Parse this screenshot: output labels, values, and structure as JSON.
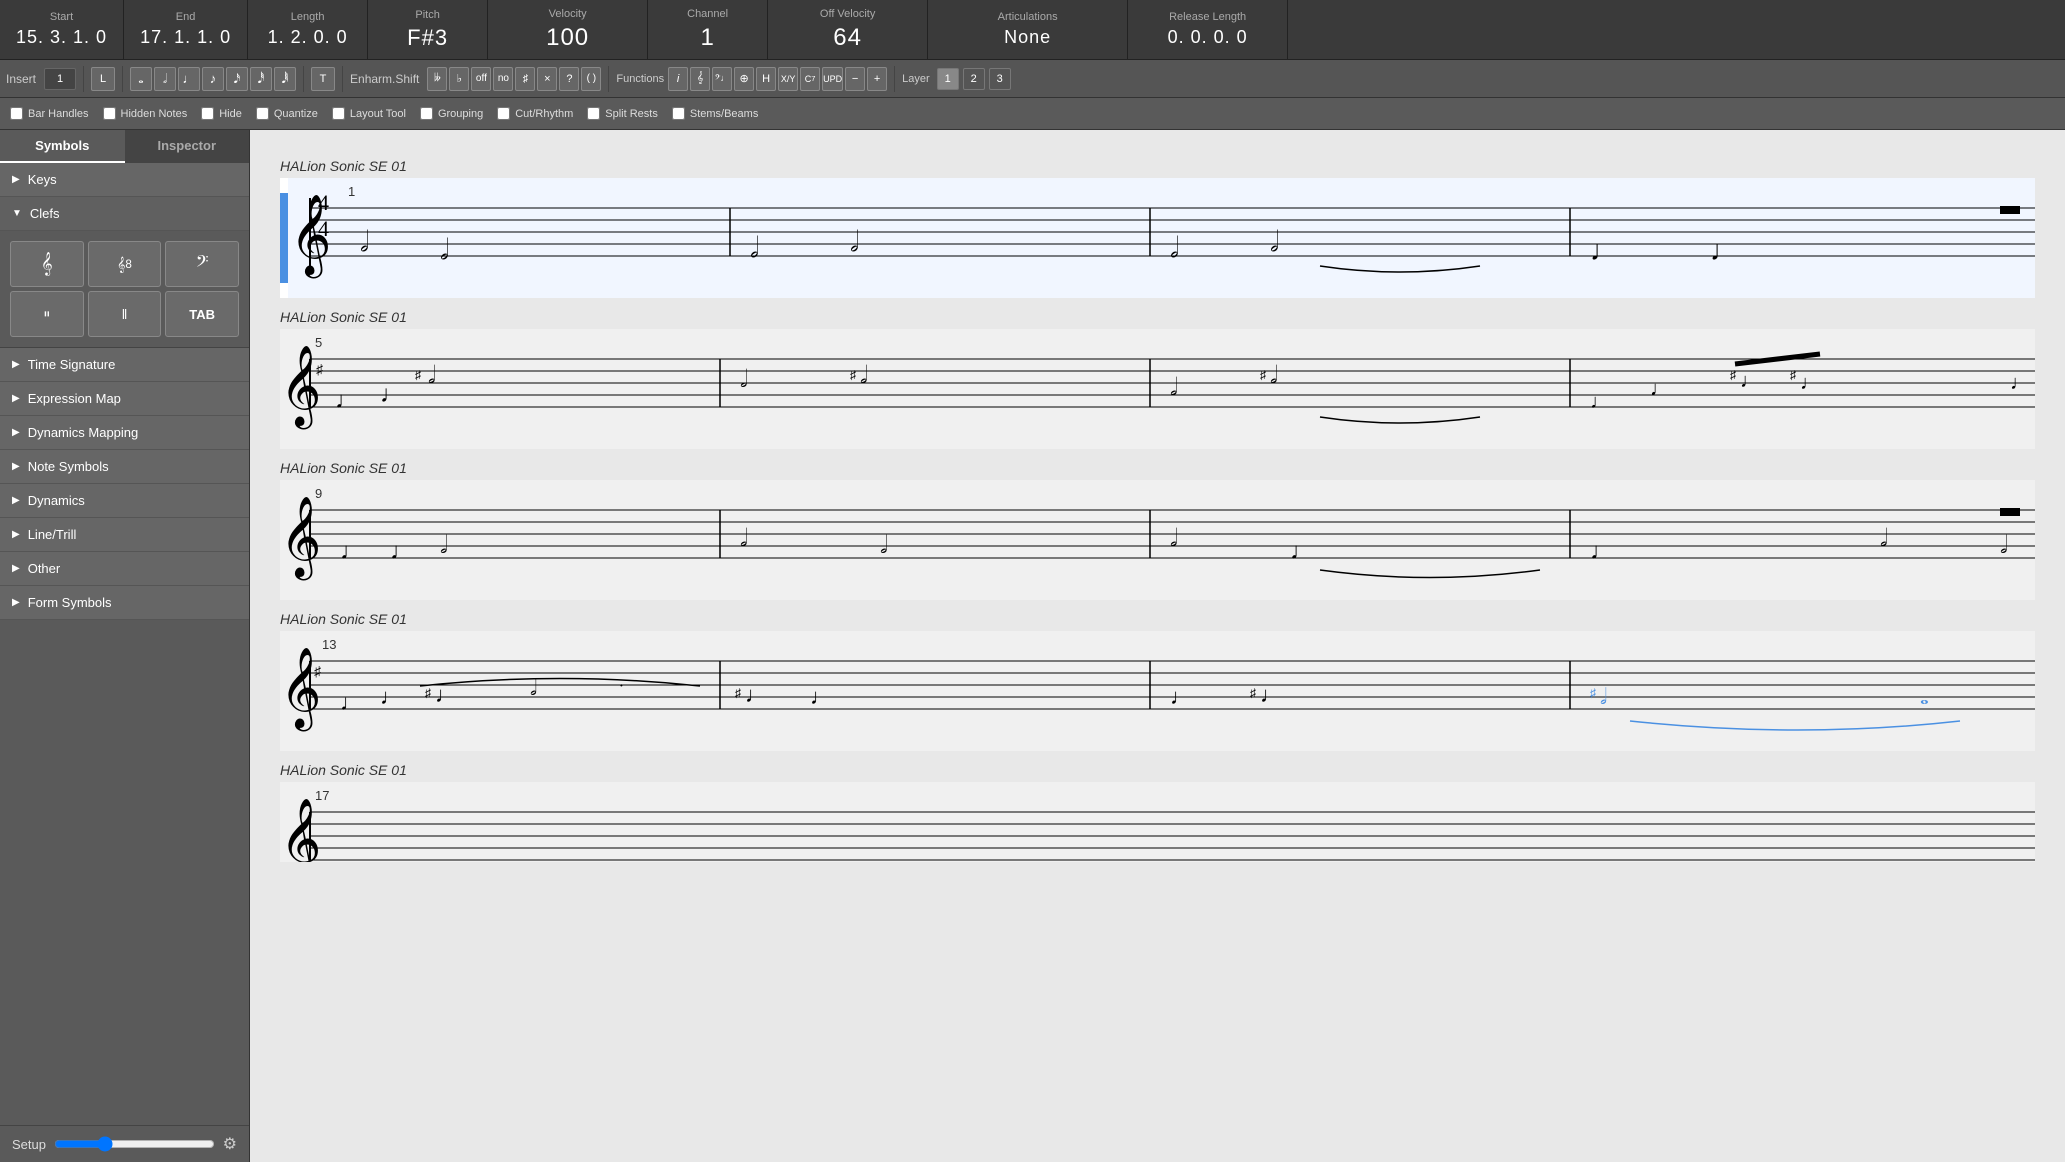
{
  "topbar": {
    "sections": [
      {
        "label": "Start",
        "value": "15. 3. 1.  0"
      },
      {
        "label": "End",
        "value": "17. 1. 1.  0"
      },
      {
        "label": "Length",
        "value": "1. 2. 0.  0"
      },
      {
        "label": "Pitch",
        "value": "F#3"
      },
      {
        "label": "Velocity",
        "value": "100"
      },
      {
        "label": "Channel",
        "value": "1"
      },
      {
        "label": "Off Velocity",
        "value": "64"
      },
      {
        "label": "Articulations",
        "value": "None"
      },
      {
        "label": "Release Length",
        "value": "0. 0. 0.  0"
      }
    ]
  },
  "toolbar": {
    "insert_label": "Insert",
    "insert_value": "1",
    "l_button": "L",
    "t_button": "T",
    "enharm_label": "Enharm.Shift",
    "functions_label": "Functions",
    "layer_label": "Layer",
    "note_buttons": [
      "𝅝",
      "𝅗𝅥",
      "𝅗",
      "𝅘𝅥𝅯",
      "𝅘𝅥𝅰",
      "𝅘𝅥𝅱",
      "𝅘𝅥𝅲"
    ],
    "acc_buttons": [
      "𝄫",
      "♭",
      "off",
      "no",
      "♯",
      "×",
      "?",
      "( )"
    ],
    "func_buttons": [
      "i",
      "𝄞",
      "𝄢",
      "⊕",
      "H",
      "X/Y",
      "C7",
      "UPD",
      "−",
      "+"
    ],
    "layers": [
      "1",
      "2",
      "3"
    ]
  },
  "checkboxes": [
    {
      "label": "Bar Handles",
      "checked": false
    },
    {
      "label": "Hidden Notes",
      "checked": false
    },
    {
      "label": "Hide",
      "checked": false
    },
    {
      "label": "Quantize",
      "checked": false
    },
    {
      "label": "Layout Tool",
      "checked": false
    },
    {
      "label": "Grouping",
      "checked": false
    },
    {
      "label": "Cut/Rhythm",
      "checked": false
    },
    {
      "label": "Split Rests",
      "checked": false
    },
    {
      "label": "Stems/Beams",
      "checked": false
    }
  ],
  "sidebar": {
    "tabs": [
      "Symbols",
      "Inspector"
    ],
    "active_tab": 0,
    "sections": [
      {
        "label": "Keys",
        "expanded": false,
        "triangle": "▶"
      },
      {
        "label": "Clefs",
        "expanded": true,
        "triangle": "▼"
      },
      {
        "label": "Time Signature",
        "expanded": false,
        "triangle": "▶"
      },
      {
        "label": "Expression Map",
        "expanded": false,
        "triangle": "▶"
      },
      {
        "label": "Dynamics Mapping",
        "expanded": false,
        "triangle": "▶"
      },
      {
        "label": "Note Symbols",
        "expanded": false,
        "triangle": "▶"
      },
      {
        "label": "Dynamics",
        "expanded": false,
        "triangle": "▶"
      },
      {
        "label": "Line/Trill",
        "expanded": false,
        "triangle": "▶"
      },
      {
        "label": "Other",
        "expanded": false,
        "triangle": "▶"
      },
      {
        "label": "Form Symbols",
        "expanded": false,
        "triangle": "▶"
      }
    ],
    "setup_label": "Setup"
  },
  "score": {
    "staves": [
      {
        "track": "HALion Sonic SE 01",
        "measure_start": 1,
        "selected": true
      },
      {
        "track": "HALion Sonic SE 01",
        "measure_start": 5,
        "selected": false
      },
      {
        "track": "HALion Sonic SE 01",
        "measure_start": 9,
        "selected": false
      },
      {
        "track": "HALion Sonic SE 01",
        "measure_start": 13,
        "selected": false
      },
      {
        "track": "HALion Sonic SE 01",
        "measure_start": 17,
        "selected": false
      }
    ]
  }
}
